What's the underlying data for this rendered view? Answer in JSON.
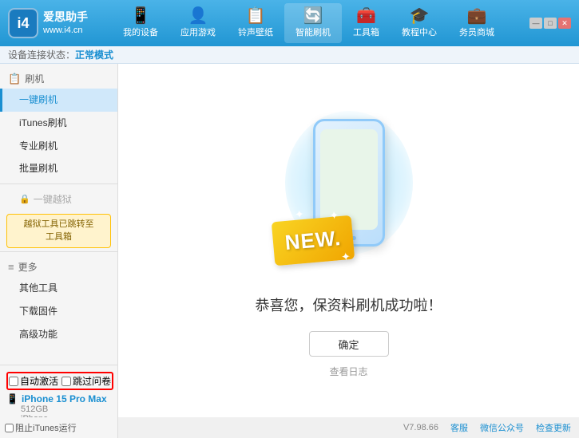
{
  "app": {
    "logo_char": "i4",
    "logo_sub": "爱思助手",
    "logo_url": "www.i4.cn"
  },
  "nav": {
    "items": [
      {
        "id": "my-device",
        "icon": "📱",
        "label": "我的设备"
      },
      {
        "id": "apps",
        "icon": "👤",
        "label": "应用游戏"
      },
      {
        "id": "ringtone",
        "icon": "📋",
        "label": "铃声壁纸"
      },
      {
        "id": "smart-flash",
        "icon": "🔄",
        "label": "智能刷机",
        "active": true
      },
      {
        "id": "tools",
        "icon": "🧰",
        "label": "工具箱"
      },
      {
        "id": "tutorial",
        "icon": "🎓",
        "label": "教程中心"
      },
      {
        "id": "service",
        "icon": "💼",
        "label": "务员商城"
      }
    ]
  },
  "status_bar": {
    "prefix": "设备连接状态：",
    "mode": "正常模式"
  },
  "sidebar": {
    "flash_section_label": "刷机",
    "items": [
      {
        "id": "one-click-flash",
        "label": "一键刷机",
        "active": true
      },
      {
        "id": "itunes-flash",
        "label": "iTunes刷机",
        "active": false
      },
      {
        "id": "pro-flash",
        "label": "专业刷机",
        "active": false
      },
      {
        "id": "batch-flash",
        "label": "批量刷机",
        "active": false
      }
    ],
    "disabled_label": "一键越狱",
    "warning_text": "越狱工具已跳转至\n工具箱",
    "more_section_label": "更多",
    "more_items": [
      {
        "id": "other-tools",
        "label": "其他工具"
      },
      {
        "id": "download-fw",
        "label": "下载固件"
      },
      {
        "id": "advanced",
        "label": "高级功能"
      }
    ]
  },
  "content": {
    "success_title": "恭喜您，保资料刷机成功啦！",
    "confirm_btn": "确定",
    "log_link": "查看日志",
    "new_badge": "NEW."
  },
  "device": {
    "icon": "📱",
    "name": "iPhone 15 Pro Max",
    "storage": "512GB",
    "type": "iPhone"
  },
  "bottom": {
    "auto_activate_label": "自动激活",
    "skip_backup_label": "跳过问卷",
    "version": "V7.98.66",
    "items": [
      "客服",
      "微信公众号",
      "检查更新"
    ]
  },
  "footer_left": {
    "itunes_label": "阻止iTunes运行"
  }
}
